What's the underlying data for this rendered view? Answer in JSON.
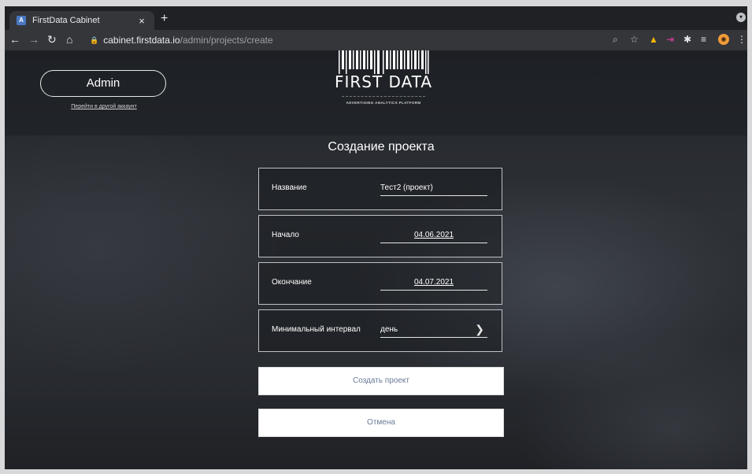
{
  "browser": {
    "tab_title": "FirstData Cabinet",
    "tab_close": "×",
    "new_tab": "+",
    "favicon_letter": "A",
    "url_host": "cabinet.firstdata.io",
    "url_path": "/admin/projects/create"
  },
  "header": {
    "account_label": "Admin",
    "switch_link": "Перейти в другой аккаунт",
    "logo_text": "FIRST DATA",
    "logo_subtitle": "ADVERTISING ANALYTICS PLATFORM"
  },
  "form": {
    "title": "Создание проекта",
    "fields": [
      {
        "label": "Название",
        "value": "Тест2 (проект)"
      },
      {
        "label": "Начало",
        "value": "04.06.2021"
      },
      {
        "label": "Окончание",
        "value": "04.07.2021"
      },
      {
        "label": "Минимальный интервал",
        "value": "день"
      }
    ],
    "submit_label": "Создать проект",
    "cancel_label": "Отмена"
  }
}
